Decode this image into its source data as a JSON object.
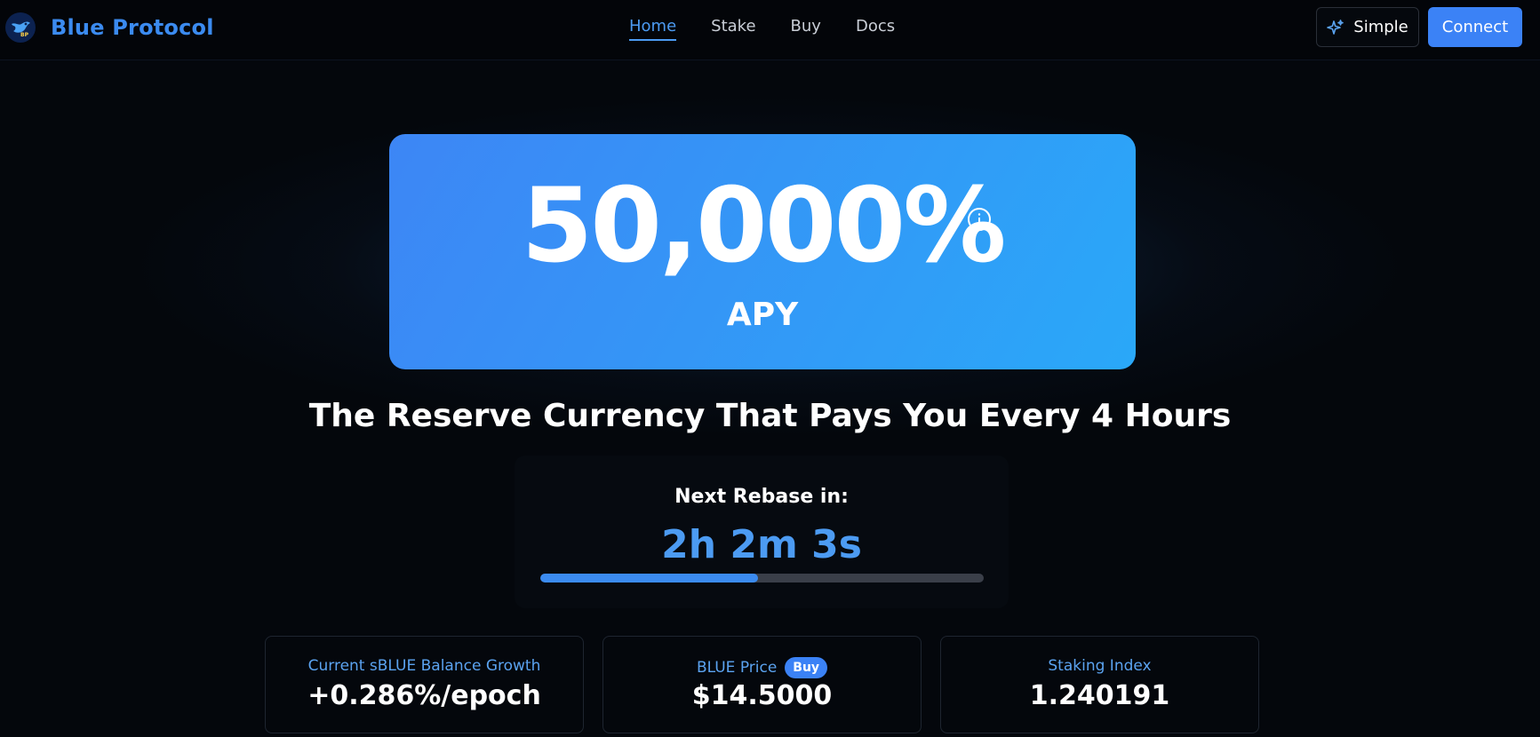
{
  "brand": {
    "name": "Blue Protocol",
    "logo_icon": "blue-bird-logo-icon"
  },
  "nav": {
    "links": [
      {
        "label": "Home",
        "active": true
      },
      {
        "label": "Stake",
        "active": false
      },
      {
        "label": "Buy",
        "active": false
      },
      {
        "label": "Docs",
        "active": false
      }
    ],
    "simple_label": "Simple",
    "simple_icon": "sparkles-icon",
    "connect_label": "Connect"
  },
  "hero": {
    "apy_value": "50,000%",
    "apy_label": "APY",
    "info_icon": "info-circle-icon",
    "headline": "The Reserve Currency That Pays You Every 4 Hours"
  },
  "rebase": {
    "title": "Next Rebase in:",
    "time": "2h 2m 3s",
    "progress_fraction": 0.49
  },
  "stats": [
    {
      "label": "Current sBLUE Balance Growth",
      "value": "+0.286%/epoch"
    },
    {
      "label": "BLUE Price",
      "badge": "Buy",
      "value": "$14.5000"
    },
    {
      "label": "Staking Index",
      "value": "1.240191"
    }
  ],
  "colors": {
    "accent": "#3b82f6",
    "link_active": "#4c9bf2",
    "background": "#04070c",
    "card_gradient_start": "#3d86f5",
    "card_gradient_end": "#2aa8f8"
  }
}
